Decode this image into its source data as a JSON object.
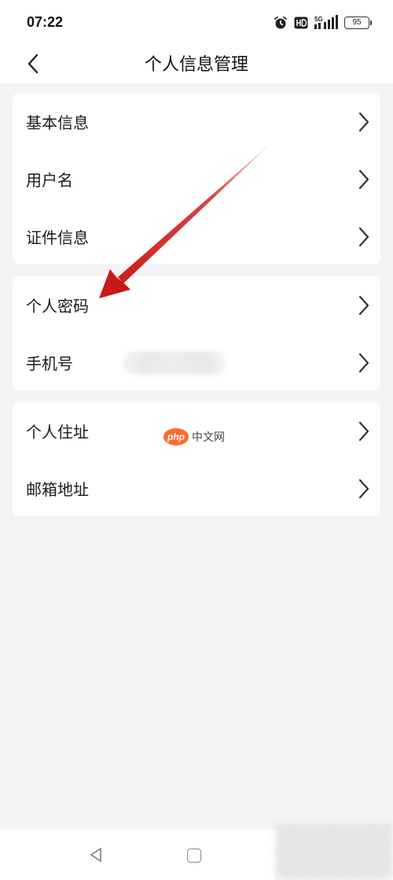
{
  "status_bar": {
    "time": "07:22",
    "icons": [
      "alarm-icon",
      "hd-icon",
      "signal-5g-icon"
    ],
    "battery": "95"
  },
  "header": {
    "title": "个人信息管理",
    "back_icon": "chevron-left-icon"
  },
  "groups": [
    {
      "items": [
        {
          "label": "基本信息"
        },
        {
          "label": "用户名"
        },
        {
          "label": "证件信息"
        }
      ]
    },
    {
      "items": [
        {
          "label": "个人密码"
        },
        {
          "label": "手机号"
        }
      ]
    },
    {
      "items": [
        {
          "label": "个人住址"
        },
        {
          "label": "邮箱地址"
        }
      ]
    }
  ],
  "watermark": {
    "logo": "php",
    "text": "中文网"
  },
  "annotation": {
    "color": "#d42020"
  }
}
